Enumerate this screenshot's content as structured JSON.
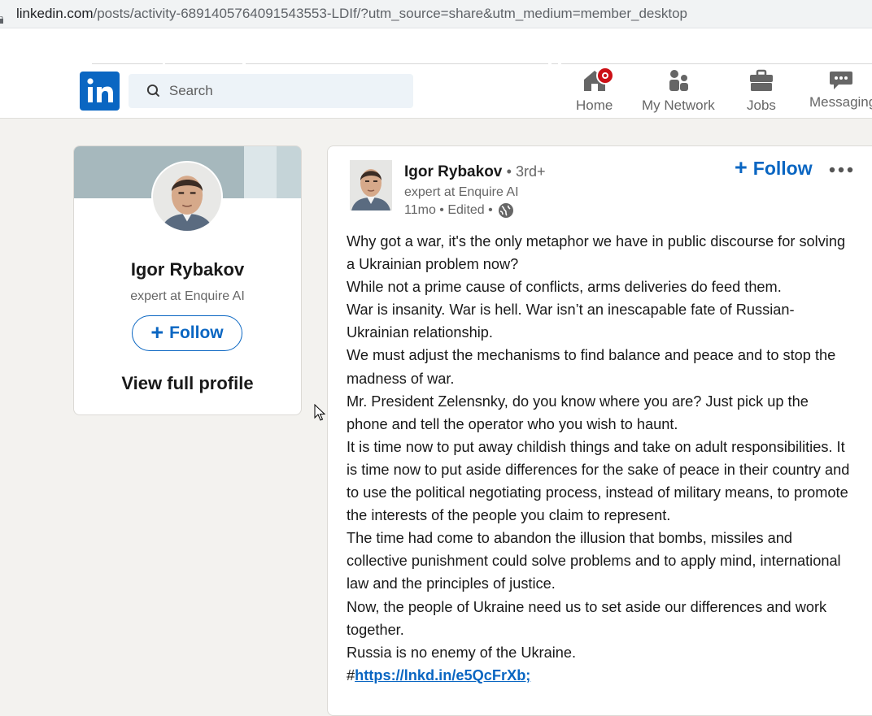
{
  "browser": {
    "url_domain": "linkedin.com",
    "url_path": "/posts/activity-6891405764091543553-LDIf/?utm_source=share&utm_medium=member_desktop"
  },
  "nav": {
    "search_placeholder": "Search",
    "items": [
      {
        "label": "Home",
        "icon": "home-icon"
      },
      {
        "label": "My Network",
        "icon": "people-icon"
      },
      {
        "label": "Jobs",
        "icon": "briefcase-icon"
      },
      {
        "label": "Messaging",
        "icon": "chat-icon"
      }
    ]
  },
  "profile_card": {
    "name": "Igor Rybakov",
    "headline": "expert at Enquire AI",
    "follow_label": "Follow",
    "view_profile_label": "View full profile"
  },
  "post": {
    "author_name": "Igor Rybakov",
    "degree": "• 3rd+",
    "headline": "expert at Enquire AI",
    "meta": "11mo • Edited •",
    "follow_label": "Follow",
    "paragraphs": [
      "Why got a war, it's the only metaphor we have in public discourse for solving a Ukrainian problem now?",
      "While not a prime cause of conflicts, arms deliveries do feed them.",
      "War is insanity. War is hell. War isn’t an inescapable fate of Russian-Ukrainian relationship.",
      "We must adjust the mechanisms to find balance and peace and to stop the madness of war.",
      "Mr. President Zelensnky, do you know where you are? Just pick up the phone and tell the operator who you wish to haunt.",
      "It is time now to put away childish things and take on adult responsibilities. It is time now to put aside differences for the sake of peace in their country and to use the political negotiating process, instead of military means, to promote the interests of the people you claim to represent.",
      "The time had come to abandon the illusion that bombs, missiles and collective punishment could solve problems and to apply mind, international law and the principles of justice.",
      "Now, the people of Ukraine need us to set aside our differences and work together.",
      "Russia is no enemy of the Ukraine."
    ],
    "link_prefix": "#",
    "link_text": "https://lnkd.in/e5QcFrXb;"
  },
  "colors": {
    "accent": "#0a66c2",
    "badge": "#cc1016",
    "page_bg": "#f3f2ef"
  }
}
